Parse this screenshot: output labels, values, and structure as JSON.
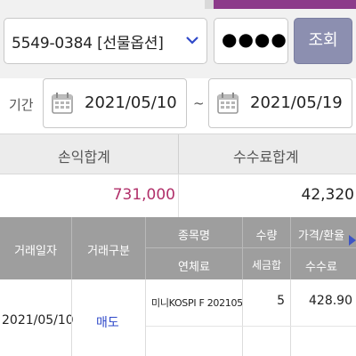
{
  "account": {
    "value": "5549-0384 [선물옵션]",
    "password_mask": "●●●●"
  },
  "search_button": "조회",
  "period": {
    "label": "기간",
    "start": "2021/05/10",
    "separator": "~",
    "end": "2021/05/19"
  },
  "summary": {
    "profit_label": "손익합계",
    "fee_label": "수수료합계",
    "profit_value": "731,000",
    "fee_value": "42,320"
  },
  "table": {
    "headers": {
      "trade_date": "거래일자",
      "trade_type": "거래구분",
      "item_name": "종목명",
      "quantity": "수량",
      "price_exchange": "가격/환율",
      "late_fee": "연체료",
      "tax_total": "세금합",
      "fee": "수수료"
    },
    "rows": [
      {
        "trade_date": "2021/05/10",
        "trade_type": "매도",
        "item_name": "미니KOSPI F 202105",
        "quantity": "5",
        "price": "428.90"
      }
    ]
  },
  "colors": {
    "brand_purple": "#8c3b8a",
    "search_button": "#8c8fb0",
    "profit": "#b1306a",
    "trade_type": "#2f49c9",
    "header_bg": "#9e9e9e"
  }
}
